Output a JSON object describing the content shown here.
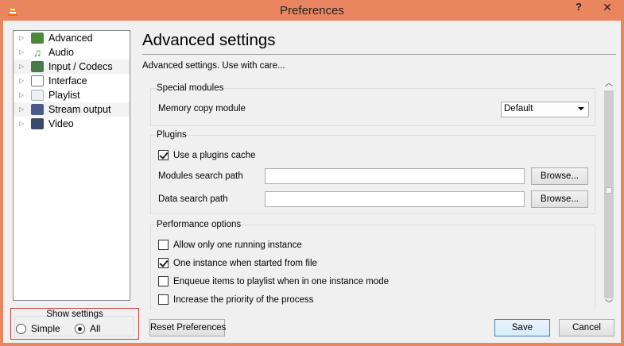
{
  "window": {
    "title": "Preferences",
    "help_label": "?",
    "close_label": "✕"
  },
  "tree": {
    "items": [
      {
        "label": "Advanced",
        "icon": "advanced-icon",
        "color": "#4a8a3a"
      },
      {
        "label": "Audio",
        "icon": "music-note-icon",
        "color": "#3a9a3a"
      },
      {
        "label": "Input / Codecs",
        "icon": "input-codecs-icon",
        "color": "#4a7a4a"
      },
      {
        "label": "Interface",
        "icon": "interface-icon",
        "color": "#6a7a9a"
      },
      {
        "label": "Playlist",
        "icon": "playlist-icon",
        "color": "#aab0c0"
      },
      {
        "label": "Stream output",
        "icon": "stream-output-icon",
        "color": "#4a5a8a"
      },
      {
        "label": "Video",
        "icon": "film-icon",
        "color": "#3a4a6a"
      }
    ]
  },
  "show_settings": {
    "title": "Show settings",
    "options": [
      {
        "label": "Simple",
        "selected": false
      },
      {
        "label": "All",
        "selected": true
      }
    ]
  },
  "panel": {
    "title": "Advanced settings",
    "description": "Advanced settings. Use with care..."
  },
  "special_modules": {
    "title": "Special modules",
    "memory_copy_label": "Memory copy module",
    "memory_copy_value": "Default"
  },
  "plugins": {
    "title": "Plugins",
    "use_cache_label": "Use a plugins cache",
    "use_cache_checked": true,
    "modules_path_label": "Modules search path",
    "modules_path_value": "",
    "data_path_label": "Data search path",
    "data_path_value": "",
    "browse_label": "Browse..."
  },
  "performance": {
    "title": "Performance options",
    "options": [
      {
        "label": "Allow only one running instance",
        "checked": false
      },
      {
        "label": "One instance when started from file",
        "checked": true
      },
      {
        "label": "Enqueue items to playlist when in one instance mode",
        "checked": false
      },
      {
        "label": "Increase the priority of the process",
        "checked": false
      }
    ]
  },
  "footer": {
    "reset_label": "Reset Preferences",
    "save_label": "Save",
    "cancel_label": "Cancel"
  },
  "colors": {
    "titlebar": "#e9865f",
    "highlight_border": "#d23c3c"
  }
}
